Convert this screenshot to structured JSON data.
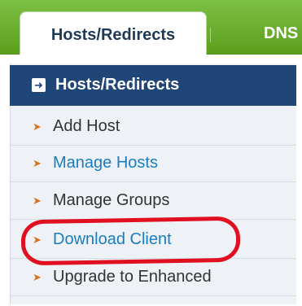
{
  "tabs": {
    "active_label": "Hosts/Redirects",
    "inactive_label": "DNS"
  },
  "panel": {
    "title": "Hosts/Redirects",
    "icon": "arrow-box-icon",
    "items": [
      {
        "label": "Add Host",
        "style": "dark"
      },
      {
        "label": "Manage Hosts",
        "style": "link"
      },
      {
        "label": "Manage Groups",
        "style": "dark"
      },
      {
        "label": "Download Client",
        "style": "link",
        "highlighted": true
      },
      {
        "label": "Upgrade to Enhanced",
        "style": "dark"
      }
    ]
  },
  "colors": {
    "tabbar": "#6aaf2c",
    "header": "#1f4677",
    "link": "#1a7dc0",
    "bullet": "#d9731c",
    "highlight": "#e01020"
  }
}
